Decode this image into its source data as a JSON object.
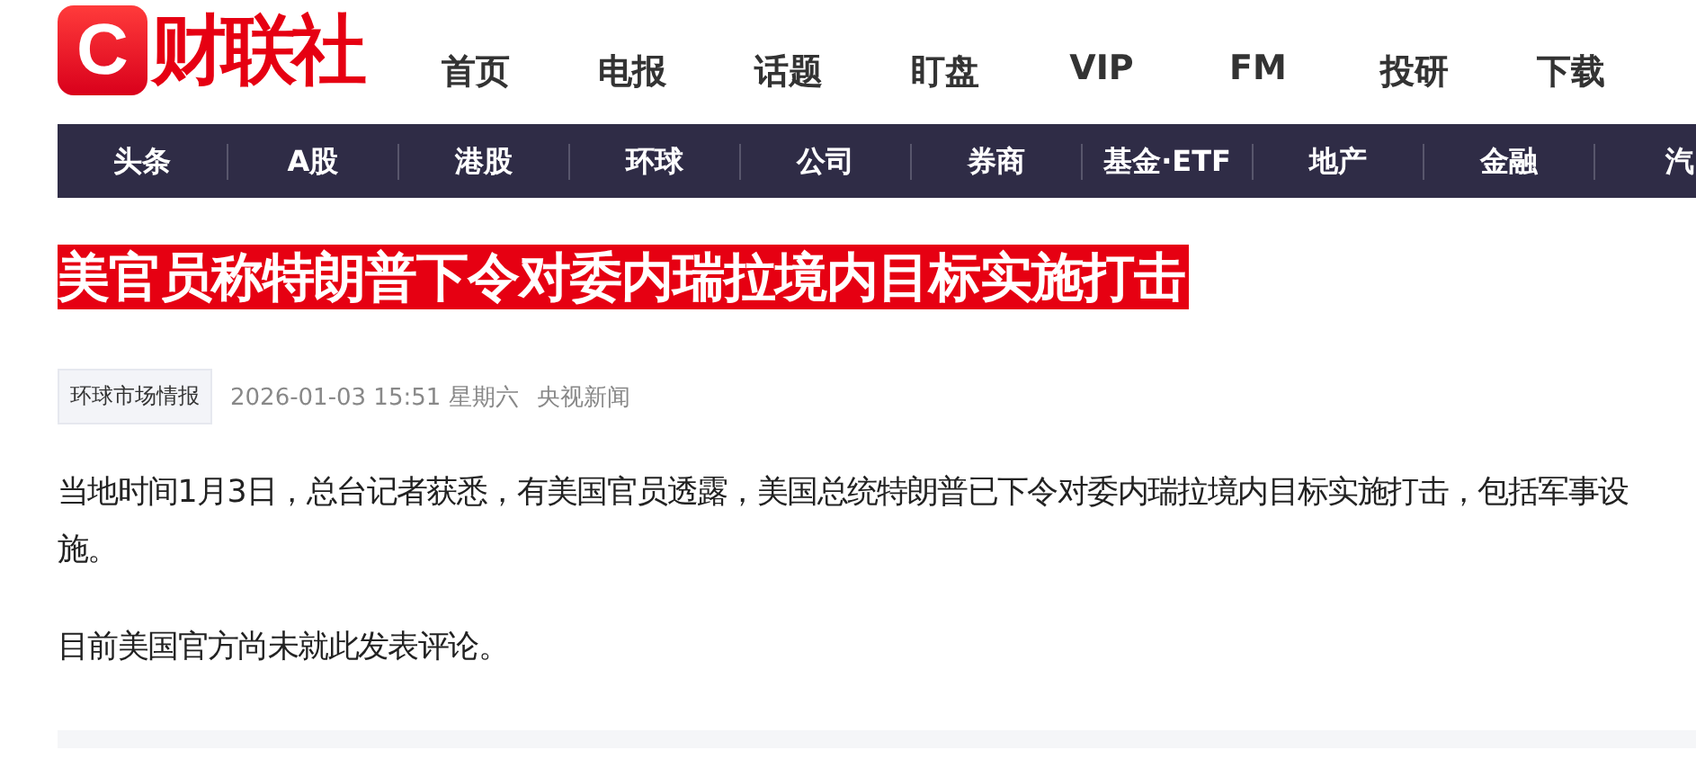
{
  "logo": {
    "mark": "C",
    "name": "财联社"
  },
  "main_nav": [
    {
      "label": "首页"
    },
    {
      "label": "电报"
    },
    {
      "label": "话题"
    },
    {
      "label": "盯盘"
    },
    {
      "label": "VIP"
    },
    {
      "label": "FM"
    },
    {
      "label": "投研"
    },
    {
      "label": "下载"
    }
  ],
  "sub_nav": [
    {
      "label": "头条"
    },
    {
      "label": "A股"
    },
    {
      "label": "港股"
    },
    {
      "label": "环球"
    },
    {
      "label": "公司"
    },
    {
      "label": "券商"
    },
    {
      "label": "基金·ETF"
    },
    {
      "label": "地产"
    },
    {
      "label": "金融"
    },
    {
      "label": "汽"
    }
  ],
  "article": {
    "title": "美官员称特朗普下令对委内瑞拉境内目标实施打击",
    "tag": "环球市场情报",
    "date": "2026-01-03 15:51 星期六",
    "source": "央视新闻",
    "paragraphs": [
      "当地时间1月3日，总台记者获悉，有美国官员透露，美国总统特朗普已下令对委内瑞拉境内目标实施打击，包括军事设施。",
      "目前美国官方尚未就此发表评论。"
    ]
  }
}
